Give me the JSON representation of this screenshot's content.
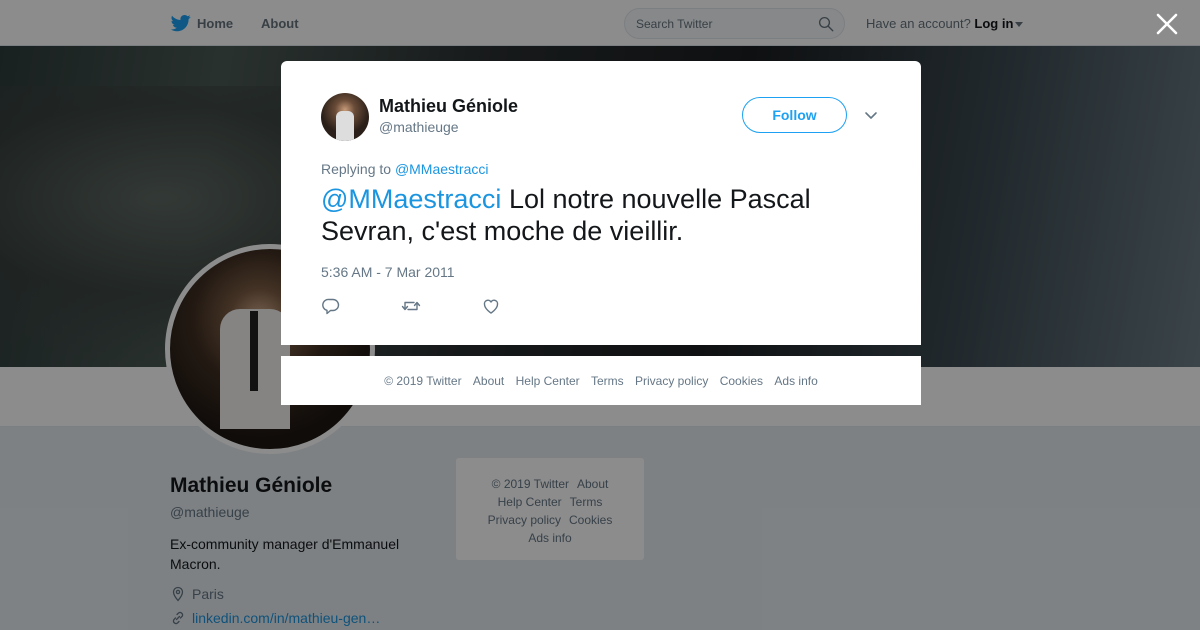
{
  "nav": {
    "home": "Home",
    "about": "About",
    "search_placeholder": "Search Twitter",
    "account_prompt": "Have an account?",
    "login": "Log in"
  },
  "profile": {
    "name": "Mathieu Géniole",
    "handle": "@mathieuge",
    "bio": "Ex-community manager d'Emmanuel Macron.",
    "location": "Paris",
    "link": "linkedin.com/in/mathieu-gen…"
  },
  "side_footer": {
    "copyright": "© 2019 Twitter",
    "about": "About",
    "help": "Help Center",
    "terms": "Terms",
    "privacy": "Privacy policy",
    "cookies": "Cookies",
    "ads": "Ads info"
  },
  "tweet": {
    "name": "Mathieu Géniole",
    "handle": "@mathieuge",
    "follow_label": "Follow",
    "replying_prefix": "Replying to",
    "replying_to": "@MMaestracci",
    "mention": "@MMaestracci",
    "text": " Lol notre nouvelle Pascal Sevran, c'est moche de vieillir.",
    "timestamp": "5:36 AM - 7 Mar 2011"
  },
  "modal_footer": {
    "copyright": "© 2019 Twitter",
    "about": "About",
    "help": "Help Center",
    "terms": "Terms",
    "privacy": "Privacy policy",
    "cookies": "Cookies",
    "ads": "Ads info"
  },
  "colors": {
    "brand": "#1da1f2",
    "link": "#1b95e0",
    "muted": "#657786",
    "overlay": "rgba(0,0,0,0.45)"
  },
  "icons": [
    "twitter-bird-icon",
    "search-icon",
    "close-icon",
    "chevron-down-icon",
    "reply-icon",
    "retweet-icon",
    "like-icon",
    "location-icon",
    "link-icon"
  ]
}
